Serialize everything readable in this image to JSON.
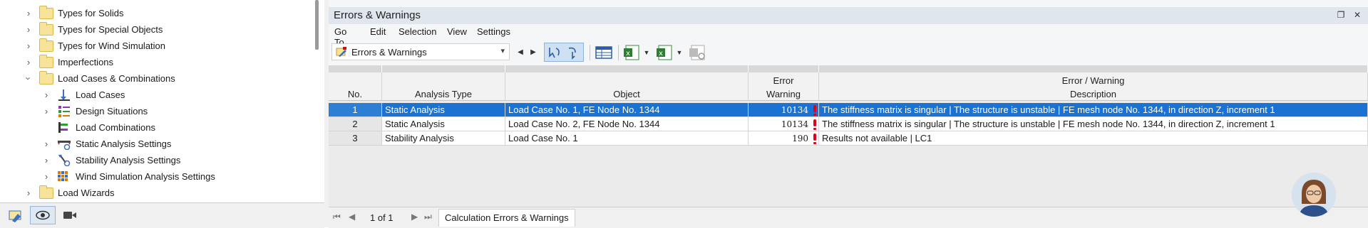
{
  "nav": {
    "items": [
      {
        "label": "Types for Solids",
        "icon": "folder-icon",
        "level": 0,
        "expanded": false
      },
      {
        "label": "Types for Special Objects",
        "icon": "folder-icon",
        "level": 0,
        "expanded": false
      },
      {
        "label": "Types for Wind Simulation",
        "icon": "folder-icon",
        "level": 0,
        "expanded": false
      },
      {
        "label": "Imperfections",
        "icon": "folder-icon",
        "level": 0,
        "expanded": false
      },
      {
        "label": "Load Cases & Combinations",
        "icon": "folder-icon",
        "level": 0,
        "expanded": true
      },
      {
        "label": "Load Cases",
        "icon": "load-cases-icon",
        "level": 1,
        "expanded": false
      },
      {
        "label": "Design Situations",
        "icon": "design-situations-icon",
        "level": 1,
        "expanded": false
      },
      {
        "label": "Load Combinations",
        "icon": "load-combinations-icon",
        "level": 1,
        "expanded": null
      },
      {
        "label": "Static Analysis Settings",
        "icon": "static-analysis-settings-icon",
        "level": 1,
        "expanded": false
      },
      {
        "label": "Stability Analysis Settings",
        "icon": "stability-analysis-settings-icon",
        "level": 1,
        "expanded": false
      },
      {
        "label": "Wind Simulation Analysis Settings",
        "icon": "wind-simulation-settings-icon",
        "level": 1,
        "expanded": false
      },
      {
        "label": "Load Wizards",
        "icon": "folder-icon",
        "level": 0,
        "expanded": false
      }
    ],
    "bottom_buttons": [
      "navigator-data-icon",
      "eye-icon",
      "camera-icon"
    ]
  },
  "panel": {
    "title": "Errors & Warnings",
    "menu": [
      "Go To",
      "Edit",
      "Selection",
      "View",
      "Settings"
    ],
    "dropdown_value": "Errors & Warnings"
  },
  "grid": {
    "headers": {
      "no": "No.",
      "analysis_type": "Analysis Type",
      "object": "Object",
      "warning_top": "Error",
      "warning_bottom": "Warning",
      "desc_top": "Error / Warning",
      "desc_bottom": "Description"
    },
    "rows": [
      {
        "no": "1",
        "analysis_type": "Static Analysis",
        "object": "Load Case No. 1, FE Node No. 1344",
        "warning": "10134",
        "description": "The stiffness matrix is singular |  The structure is unstable | FE mesh node No. 1344, in direction Z, increment 1",
        "selected": true
      },
      {
        "no": "2",
        "analysis_type": "Static Analysis",
        "object": "Load Case No. 2, FE Node No. 1344",
        "warning": "10134",
        "description": "The stiffness matrix is singular |  The structure is unstable | FE mesh node No. 1344, in direction Z, increment 1",
        "selected": false
      },
      {
        "no": "3",
        "analysis_type": "Stability Analysis",
        "object": "Load Case No. 1",
        "warning": "190",
        "description": "Results not available | LC1",
        "selected": false
      }
    ]
  },
  "bottombar": {
    "page_info": "1 of 1",
    "tab": "Calculation Errors & Warnings"
  },
  "colors": {
    "selection": "#1a73d2",
    "error": "#e2001a",
    "title_bar": "#dfe6ee"
  }
}
